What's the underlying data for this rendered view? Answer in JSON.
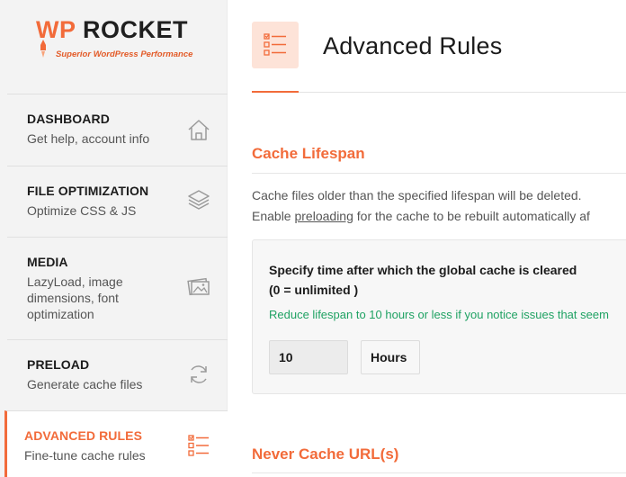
{
  "brand": {
    "logo_wp": "WP",
    "logo_rocket": "ROCKET",
    "tagline": "Superior WordPress Performance",
    "accent_color": "#f26b3a",
    "success_color": "#1fa263"
  },
  "sidebar": {
    "items": [
      {
        "title": "DASHBOARD",
        "subtitle": "Get help, account info",
        "icon": "home-icon"
      },
      {
        "title": "FILE OPTIMIZATION",
        "subtitle": "Optimize CSS & JS",
        "icon": "layers-icon"
      },
      {
        "title": "MEDIA",
        "subtitle": "LazyLoad, image dimensions, font optimization",
        "icon": "images-icon"
      },
      {
        "title": "PRELOAD",
        "subtitle": "Generate cache files",
        "icon": "refresh-icon"
      },
      {
        "title": "ADVANCED RULES",
        "subtitle": "Fine-tune cache rules",
        "icon": "list-check-icon",
        "active": true
      }
    ]
  },
  "main": {
    "page_title": "Advanced Rules",
    "page_icon": "list-check-icon",
    "cache_lifespan": {
      "title": "Cache Lifespan",
      "desc_line1": "Cache files older than the specified lifespan will be deleted.",
      "desc_line2_prefix": "Enable ",
      "desc_line2_link": "preloading",
      "desc_line2_suffix": " for the cache to be rebuilt automatically af",
      "panel_label_line1": "Specify time after which the global cache is cleared",
      "panel_label_line2": "(0 = unlimited )",
      "hint": "Reduce lifespan to 10 hours or less if you notice issues that seem",
      "value": "10",
      "unit": "Hours"
    },
    "never_cache": {
      "title": "Never Cache URL(s)"
    }
  }
}
